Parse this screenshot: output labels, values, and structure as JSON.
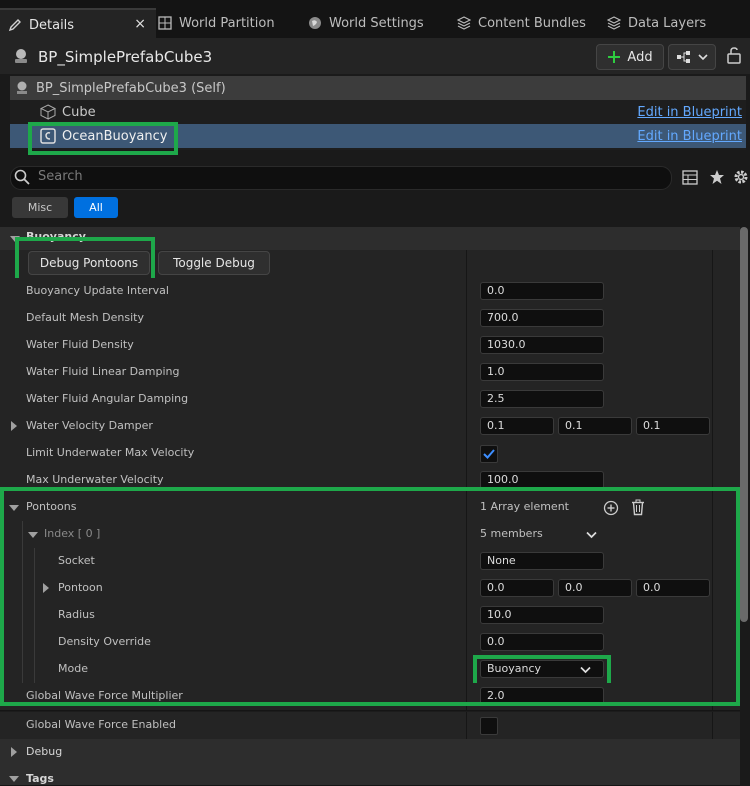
{
  "tabs": [
    {
      "label": "Details",
      "icon": "pencil-icon"
    },
    {
      "label": "World Partition",
      "icon": "grid-icon"
    },
    {
      "label": "World Settings",
      "icon": "globe-icon"
    },
    {
      "label": "Content Bundles",
      "icon": "layers-icon"
    },
    {
      "label": "Data Layers",
      "icon": "layers-icon"
    }
  ],
  "tab_close": "×",
  "header": {
    "actor_name": "BP_SimplePrefabCube3",
    "add_label": "Add"
  },
  "components": {
    "self_label": "BP_SimplePrefabCube3 (Self)",
    "items": [
      {
        "label": "Cube",
        "edit": "Edit in Blueprint",
        "selected": false
      },
      {
        "label": "OceanBuoyancy",
        "edit": "Edit in Blueprint",
        "selected": true
      }
    ]
  },
  "search": {
    "placeholder": "Search"
  },
  "filters": [
    {
      "label": "Misc",
      "active": false
    },
    {
      "label": "All",
      "active": true
    }
  ],
  "category_buoyancy": "Buoyancy",
  "buttons": {
    "debug_pontoons": "Debug Pontoons",
    "toggle_debug": "Toggle Debug"
  },
  "props": {
    "update_interval": {
      "label": "Buoyancy Update Interval",
      "value": "0.0"
    },
    "mesh_density": {
      "label": "Default Mesh Density",
      "value": "700.0"
    },
    "fluid_density": {
      "label": "Water Fluid Density",
      "value": "1030.0"
    },
    "linear_damping": {
      "label": "Water Fluid Linear Damping",
      "value": "1.0"
    },
    "angular_damping": {
      "label": "Water Fluid Angular Damping",
      "value": "2.5"
    },
    "velocity_damper": {
      "label": "Water Velocity Damper",
      "x": "0.1",
      "y": "0.1",
      "z": "0.1"
    },
    "limit_velocity": {
      "label": "Limit Underwater Max Velocity",
      "checked": true
    },
    "max_velocity": {
      "label": "Max Underwater Velocity",
      "value": "100.0"
    },
    "pontoons": {
      "label": "Pontoons",
      "count": "1 Array element"
    },
    "index0": {
      "label": "Index [ 0 ]",
      "members": "5 members"
    },
    "socket": {
      "label": "Socket",
      "value": "None"
    },
    "pontoon": {
      "label": "Pontoon",
      "x": "0.0",
      "y": "0.0",
      "z": "0.0"
    },
    "radius": {
      "label": "Radius",
      "value": "10.0"
    },
    "density_override": {
      "label": "Density Override",
      "value": "0.0"
    },
    "mode": {
      "label": "Mode",
      "value": "Buoyancy"
    },
    "wave_force": {
      "label": "Global Wave Force Multiplier",
      "value": "2.0"
    },
    "wave_enabled": {
      "label": "Global Wave Force Enabled",
      "checked": false
    }
  },
  "category_debug": "Debug",
  "category_tags": "Tags",
  "colors": {
    "highlight": "#1ea84a",
    "accent": "#0070e0",
    "link": "#63a9ff"
  }
}
